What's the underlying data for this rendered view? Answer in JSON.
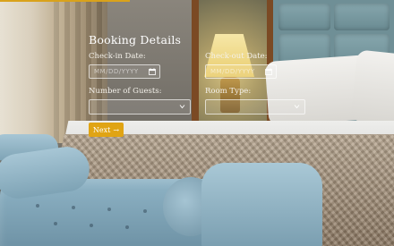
{
  "form": {
    "title": "Booking Details",
    "checkin": {
      "label": "Check-in Date:",
      "placeholder": "MM/DD/YYYY",
      "icon": "calendar-icon"
    },
    "checkout": {
      "label": "Check-out Date:",
      "placeholder": "MM/DD/YYYY",
      "icon": "calendar-icon"
    },
    "guests": {
      "label": "Number of Guests:",
      "value": "",
      "icon": "chevron-down-icon"
    },
    "room_type": {
      "label": "Room Type:",
      "value": "",
      "icon": "chevron-down-icon"
    },
    "next_button": {
      "label": "Next",
      "arrow": "→"
    }
  },
  "colors": {
    "accent": "#e0a414",
    "text": "#ffffff"
  }
}
